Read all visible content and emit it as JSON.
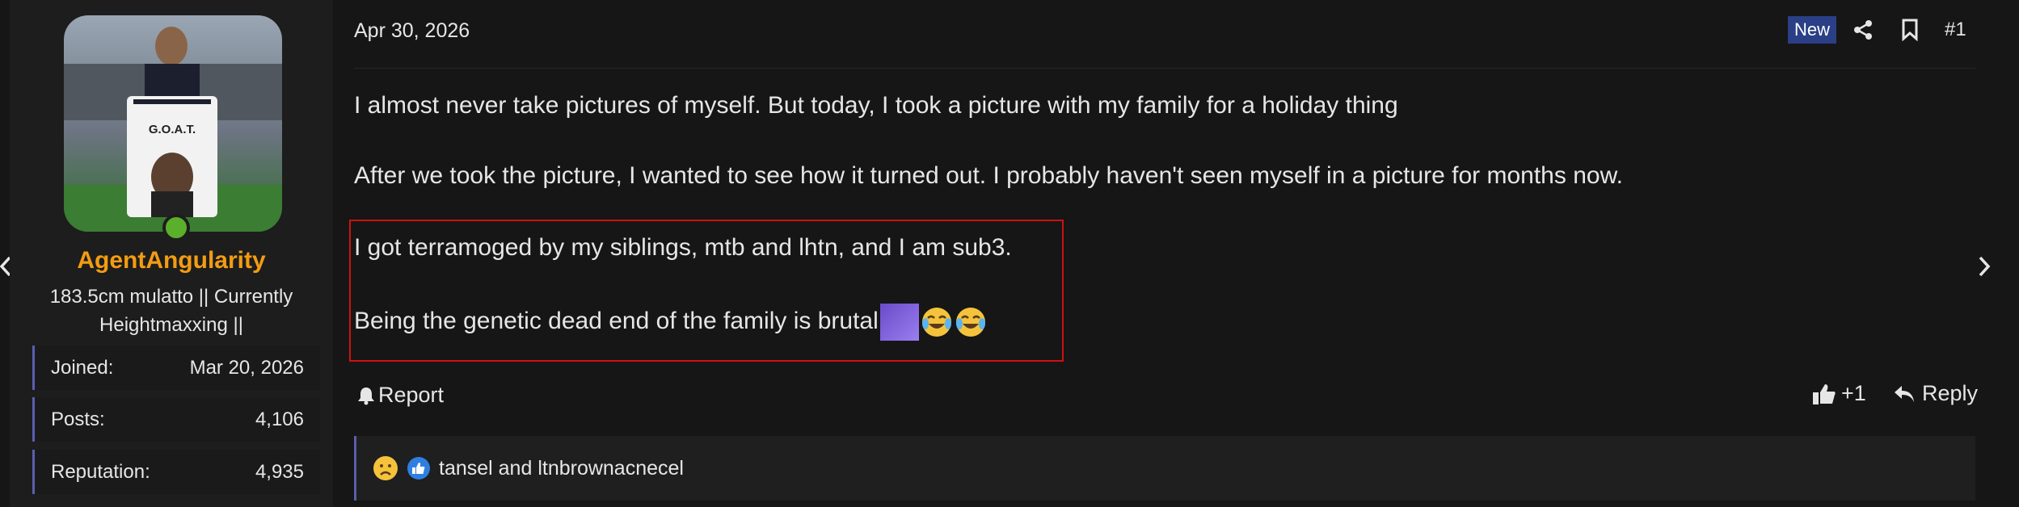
{
  "user": {
    "name": "AgentAngularity",
    "title": "183.5cm mulatto || Currently Heightmaxxing ||",
    "avatar_shirt_text": "G.O.A.T.",
    "stats": [
      {
        "label": "Joined:",
        "value": "Mar 20, 2026"
      },
      {
        "label": "Posts:",
        "value": "4,106"
      },
      {
        "label": "Reputation:",
        "value": "4,935"
      }
    ]
  },
  "post": {
    "date": "Apr 30, 2026",
    "badge": "New",
    "number": "#1",
    "paragraphs": [
      "I almost never take pictures of myself. But today, I took a picture with my family for a holiday thing",
      "After we took the picture, I wanted to see how it turned out. I probably haven't seen myself in a picture for months now.",
      "I got terramoged by my siblings, mtb and lhtn, and I am sub3.",
      "Being the genetic dead end of the family is brutal"
    ],
    "report_label": "Report",
    "like_label": "+1",
    "reply_label": "Reply",
    "reactions_text": "tansel and ltnbrownacnecel"
  },
  "colors": {
    "username": "#f39c12",
    "online": "#5ab02a",
    "accent": "#5a5fb0",
    "badge_bg": "#2a3f86",
    "highlight": "#d01010"
  },
  "icons": [
    "chevron-left-icon",
    "chevron-right-icon",
    "share-icon",
    "bookmark-icon",
    "bell-icon",
    "thumbs-up-icon",
    "reply-icon",
    "sad-face-icon",
    "like-reaction-icon",
    "crying-laughing-icon"
  ]
}
